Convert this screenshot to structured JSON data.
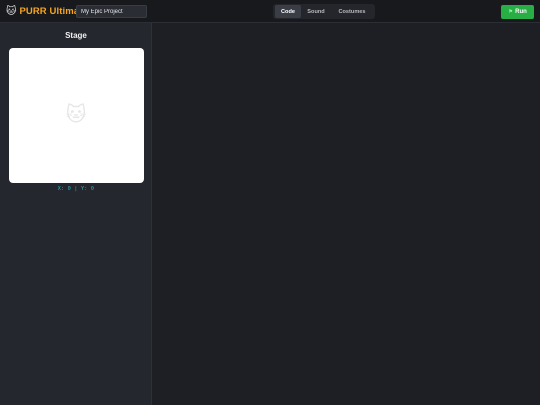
{
  "header": {
    "logo_icon": "cat-face-icon",
    "logo_glyph": "🐱",
    "app_name": "PURR Ultimate",
    "project_name": "My Epic Project",
    "tabs": [
      {
        "label": "Code",
        "active": true
      },
      {
        "label": "Sound",
        "active": false
      },
      {
        "label": "Costumes",
        "active": false
      }
    ],
    "run_label": "Run",
    "run_icon": "flag-icon",
    "run_glyph": "⚑"
  },
  "sidebar": {
    "stage_title": "Stage",
    "sprite_glyph": "🐱",
    "sprite_icon": "cat-sprite",
    "coords_text": "X: 0 | Y: 0"
  },
  "colors": {
    "brand": "#f5a623",
    "run": "#27ae45",
    "coords": "#2bb9c9"
  }
}
